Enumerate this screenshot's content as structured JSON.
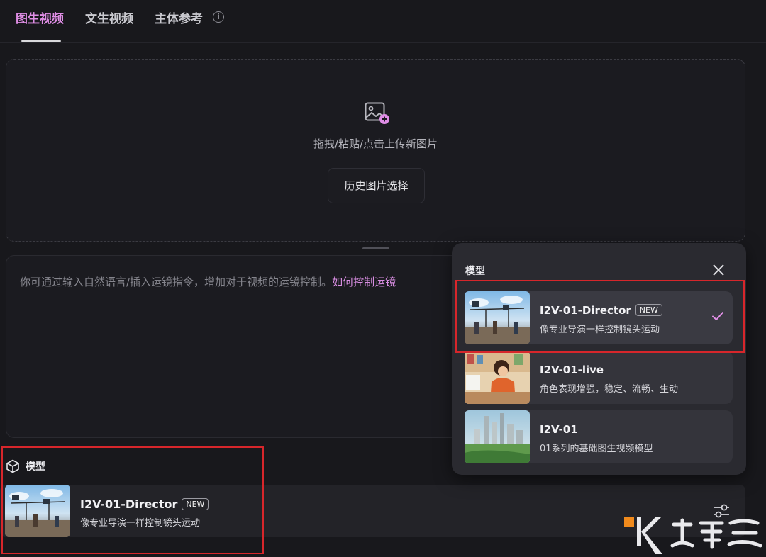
{
  "tabs": [
    {
      "label": "图生视频",
      "active": true
    },
    {
      "label": "文生视频",
      "active": false
    },
    {
      "label": "主体参考",
      "active": false
    }
  ],
  "upload": {
    "icon": "image-add-icon",
    "hint": "拖拽/粘贴/点击上传新图片",
    "history_button": "历史图片选择"
  },
  "prompt": {
    "placeholder": "你可通过输入自然语言/插入运镜指令，增加对于视频的运镜控制。",
    "link": "如何控制运镜"
  },
  "model_section": {
    "title": "模型",
    "selected": {
      "name": "I2V-01-Director",
      "badge": "NEW",
      "description": "像专业导演一样控制镜头运动"
    }
  },
  "model_popup": {
    "title": "模型",
    "options": [
      {
        "name": "I2V-01-Director",
        "badge": "NEW",
        "description": "像专业导演一样控制镜头运动",
        "selected": true
      },
      {
        "name": "I2V-01-live",
        "badge": "",
        "description": "角色表现增强，稳定、流畅、生动",
        "selected": false
      },
      {
        "name": "I2V-01",
        "badge": "",
        "description": "01系列的基础图生视频模型",
        "selected": false
      }
    ]
  },
  "colors": {
    "accent": "#e08ee6",
    "link": "#d98ee2",
    "highlight": "#d7262b",
    "background": "#18181c"
  }
}
